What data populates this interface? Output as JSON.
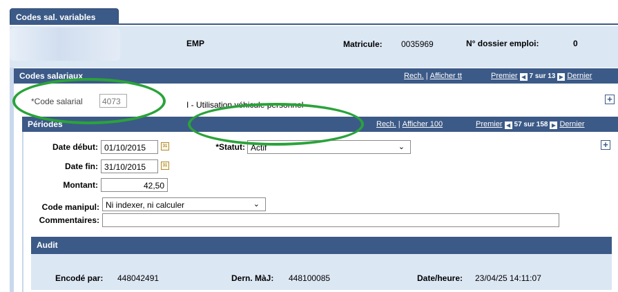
{
  "tab": {
    "label": "Codes sal. variables"
  },
  "header": {
    "emp_label": "EMP",
    "matricule_label": "Matricule:",
    "matricule_value": "0035969",
    "dossier_label": "N° dossier emploi:",
    "dossier_value": "0"
  },
  "codes_salariaux": {
    "title": "Codes salariaux",
    "rech": "Rech.",
    "afficher": "Afficher tt",
    "premier": "Premier",
    "count": "7 sur 13",
    "dernier": "Dernier",
    "code_label": "*Code salarial",
    "code_value": "4073",
    "code_desc": "I - Utilisation véhicule personnel"
  },
  "periodes": {
    "title": "Périodes",
    "rech": "Rech.",
    "afficher": "Afficher 100",
    "premier": "Premier",
    "count": "57 sur 158",
    "dernier": "Dernier",
    "date_debut_label": "Date début:",
    "date_debut_value": "01/10/2015",
    "date_fin_label": "Date fin:",
    "date_fin_value": "31/10/2015",
    "montant_label": "Montant:",
    "montant_value": "42,50",
    "statut_label": "*Statut:",
    "statut_value": "Actif",
    "code_manipul_label": "Code manipul:",
    "code_manipul_value": "Ni indexer, ni calculer",
    "commentaires_label": "Commentaires:",
    "commentaires_value": "",
    "cal_glyph": "31"
  },
  "audit": {
    "title": "Audit",
    "encode_label": "Encodé par:",
    "encode_value": "448042491",
    "dern_label": "Dern. MàJ:",
    "dern_value": "448100085",
    "date_label": "Date/heure:",
    "date_value": "23/04/25 14:11:07"
  },
  "icons": {
    "plus": "+",
    "first": "◀",
    "last": "▶",
    "chevron": "⌄"
  },
  "colors": {
    "bar": "#3c5a87",
    "band": "#dce7f4",
    "highlight": "#2aa33a"
  }
}
